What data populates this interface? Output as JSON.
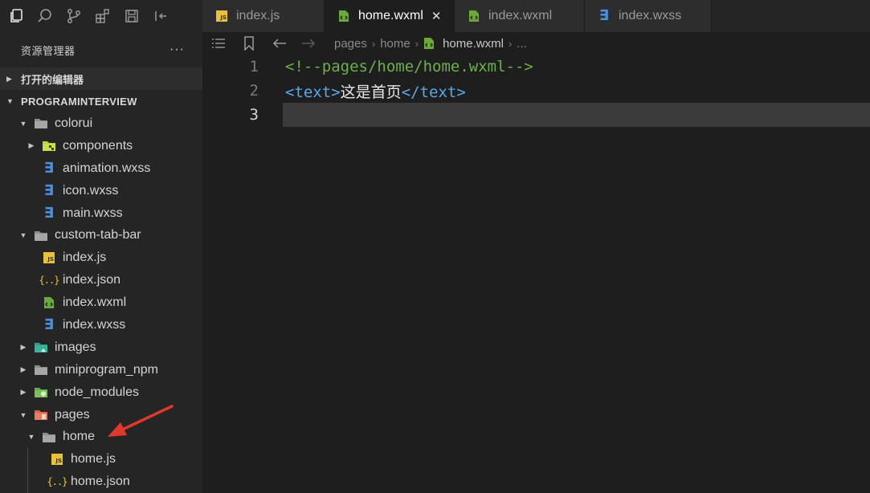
{
  "activity_bar": {
    "icons": [
      "files-icon",
      "search-icon",
      "source-control-icon",
      "extensions-icon",
      "save-icon",
      "collapse-panel-icon"
    ]
  },
  "explorer": {
    "title": "资源管理器",
    "more": "···",
    "open_editors_label": "打开的编辑器",
    "project_label": "PROGRAMINTERVIEW"
  },
  "tree": [
    {
      "label": "colorui",
      "type": "folder",
      "depth": 1,
      "expanded": true
    },
    {
      "label": "components",
      "type": "folder-components",
      "depth": 2,
      "expanded": false
    },
    {
      "label": "animation.wxss",
      "type": "wxss",
      "depth": 2
    },
    {
      "label": "icon.wxss",
      "type": "wxss",
      "depth": 2
    },
    {
      "label": "main.wxss",
      "type": "wxss",
      "depth": 2
    },
    {
      "label": "custom-tab-bar",
      "type": "folder",
      "depth": 1,
      "expanded": true
    },
    {
      "label": "index.js",
      "type": "js",
      "depth": 2
    },
    {
      "label": "index.json",
      "type": "json",
      "depth": 2
    },
    {
      "label": "index.wxml",
      "type": "wxml",
      "depth": 2
    },
    {
      "label": "index.wxss",
      "type": "wxss",
      "depth": 2
    },
    {
      "label": "images",
      "type": "folder-images",
      "depth": 1,
      "expanded": false
    },
    {
      "label": "miniprogram_npm",
      "type": "folder",
      "depth": 1,
      "expanded": false
    },
    {
      "label": "node_modules",
      "type": "folder-node",
      "depth": 1,
      "expanded": false
    },
    {
      "label": "pages",
      "type": "folder-pages",
      "depth": 1,
      "expanded": true
    },
    {
      "label": "home",
      "type": "folder",
      "depth": 2,
      "expanded": true
    },
    {
      "label": "home.js",
      "type": "js",
      "depth": 3
    },
    {
      "label": "home.json",
      "type": "json",
      "depth": 3
    }
  ],
  "tabs": [
    {
      "label": "index.js",
      "type": "js",
      "active": false
    },
    {
      "label": "home.wxml",
      "type": "wxml",
      "active": true
    },
    {
      "label": "index.wxml",
      "type": "wxml",
      "active": false
    },
    {
      "label": "index.wxss",
      "type": "wxss",
      "active": false
    }
  ],
  "breadcrumb": {
    "items": [
      "pages",
      "home"
    ],
    "current": "home.wxml",
    "ellipsis": "..."
  },
  "editor": {
    "line_numbers": [
      "1",
      "2",
      "3"
    ],
    "line1_comment": "<!--pages/home/home.wxml-->",
    "line2_open": "<",
    "line2_tag": "text",
    "line2_close": ">",
    "line2_text": "这是首页",
    "line2_end_open": "</",
    "line2_end_tag": "text",
    "line2_end_close": ">",
    "current_line": 3
  },
  "colors": {
    "accent_arrow": "#e0392b",
    "comment": "#6ab04c",
    "tag": "#5aa8e8",
    "js_badge": "#e8c23a",
    "wxss": "#4a90e2",
    "wxml": "#6aaa3a"
  }
}
